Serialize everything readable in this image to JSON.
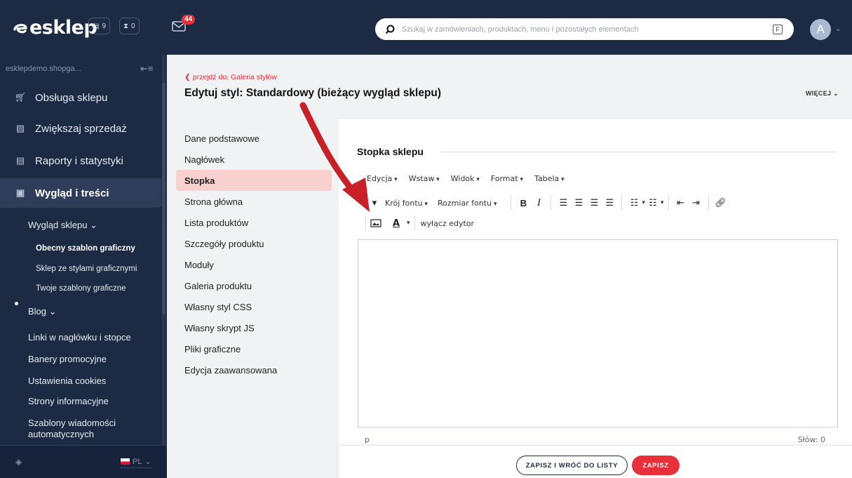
{
  "topbar": {
    "logo": "esklep",
    "counters": [
      {
        "icon": "document-icon",
        "value": "9"
      },
      {
        "icon": "hourglass-icon",
        "value": "0"
      }
    ],
    "mail_badge": "44",
    "search_placeholder": "Szukaj w zamówieniach, produktach, menu i pozostałych elementach",
    "search_shortcut": "F",
    "avatar": "A"
  },
  "sidebar": {
    "domain": "esklepdemo.shopga...",
    "main_items": [
      {
        "label": "Obsługa sklepu",
        "icon": "cart-icon"
      },
      {
        "label": "Zwiększaj sprzedaż",
        "icon": "chart-icon"
      },
      {
        "label": "Raporty i statystyki",
        "icon": "report-icon"
      },
      {
        "label": "Wygląd i treści",
        "icon": "image-icon"
      }
    ],
    "appearance_label": "Wygląd sklepu",
    "appearance_items": [
      "Obecny szablon graficzny",
      "Sklep ze stylami graficznymi",
      "Twoje szablony graficzne"
    ],
    "blog_label": "Blog",
    "other_items": [
      "Linki w nagłówku i stopce",
      "Banery promocyjne",
      "Ustawienia cookies",
      "Strony informacyjne",
      "Szablony wiadomości automatycznych"
    ],
    "language": "PL"
  },
  "content": {
    "back_link": "przejdź do: Galeria stylów",
    "title": "Edytuj styl: Standardowy (bieżący wygląd sklepu)",
    "more": "WIĘCEJ",
    "sections": [
      "Dane podstawowe",
      "Nagłówek",
      "Stopka",
      "Strona główna",
      "Lista produktów",
      "Szczegóły produktu",
      "Moduły",
      "Galeria produktu",
      "Własny styl CSS",
      "Własny skrypt JS",
      "Pliki graficzne",
      "Edycja zaawansowana"
    ],
    "active_section": "Stopka"
  },
  "editor": {
    "heading": "Stopka sklepu",
    "menus": [
      "Edycja",
      "Wstaw",
      "Widok",
      "Format",
      "Tabela"
    ],
    "font_family": "Krój fontu",
    "font_size": "Rozmiar fontu",
    "disable_editor": "wyłącz edytor",
    "status_path": "p",
    "word_count": "Słów: 0"
  },
  "actions": {
    "save_back": "ZAPISZ I WRÓĆ DO LISTY",
    "save": "ZAPISZ"
  },
  "colors": {
    "navy": "#1c2a43",
    "accent_red": "#e8303b",
    "active_section_bg": "#f7d0cf"
  }
}
